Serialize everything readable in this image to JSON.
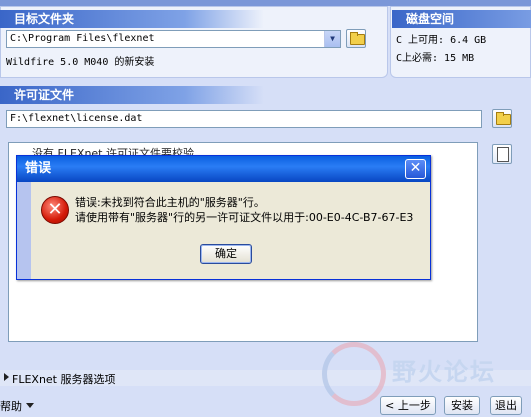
{
  "target_folder": {
    "title": "目标文件夹",
    "path": "C:\\Program Files\\flexnet",
    "info": "Wildfire 5.0 M040 的新安装"
  },
  "disk_space": {
    "title": "磁盘空间",
    "available": "C 上可用: 6.4 GB",
    "required": "C上必需: 15 MB"
  },
  "license": {
    "title": "许可证文件",
    "path": "F:\\flexnet\\license.dat",
    "partial_text": "没有 FLEXnet 许可证文件要校验"
  },
  "error_dialog": {
    "title": "错误",
    "close_glyph": "✕",
    "icon_glyph": "✕",
    "message_line1": "错误:未找到符合此主机的\"服务器\"行。",
    "message_line2": "请使用带有\"服务器\"行的另一许可证文件以用于:00-E0-4C-B7-67-E3",
    "ok_label": "确定"
  },
  "options": {
    "label": "FLEXnet 服务器选项"
  },
  "footer": {
    "help_label": "帮助",
    "back_label": "< 上一步",
    "install_label": "安装",
    "exit_label": "退出"
  },
  "watermark": {
    "brand": "野火论坛"
  }
}
